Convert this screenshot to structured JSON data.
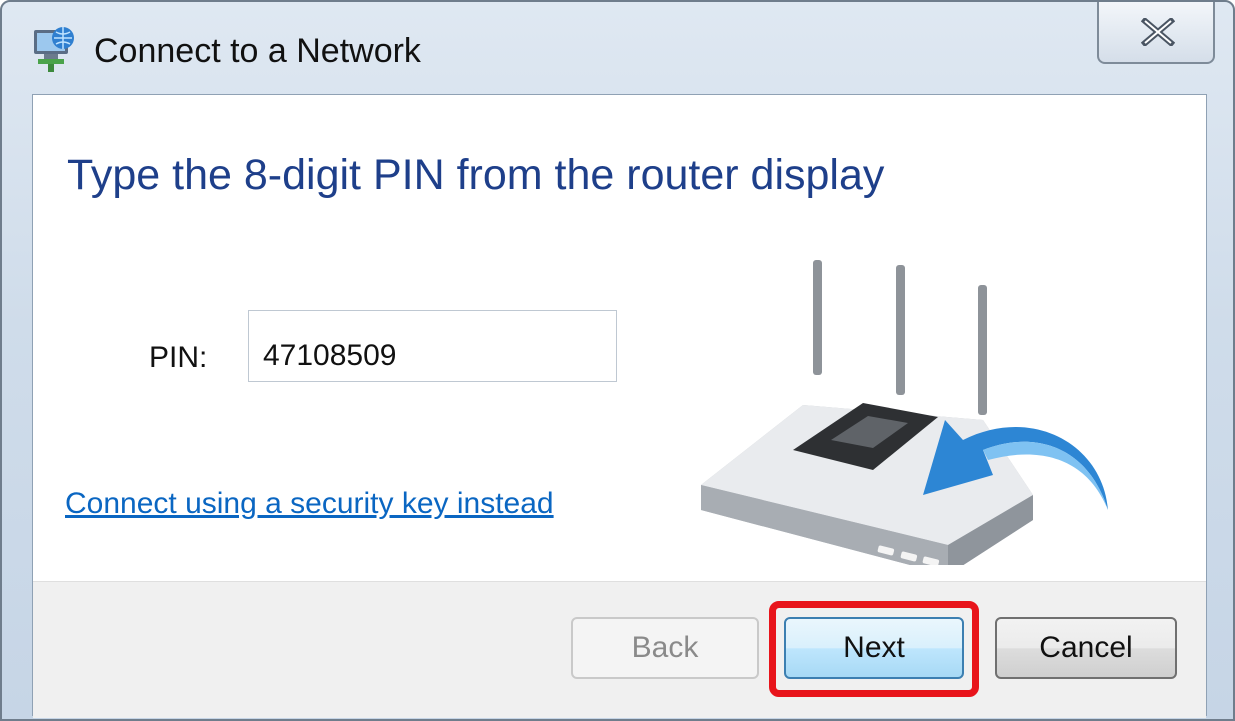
{
  "window": {
    "title": "Connect to a Network",
    "icon": "network-globe-icon",
    "close_icon": "close-icon"
  },
  "content": {
    "heading": "Type the 8-digit PIN from the router display",
    "pin_label": "PIN:",
    "pin_value": "47108509",
    "link_text": "Connect using a security key instead",
    "illustration": "router-icon"
  },
  "buttons": {
    "back": "Back",
    "next": "Next",
    "cancel": "Cancel"
  },
  "colors": {
    "heading": "#1e3f8a",
    "link": "#0a66c2",
    "highlight": "#e8141b"
  }
}
